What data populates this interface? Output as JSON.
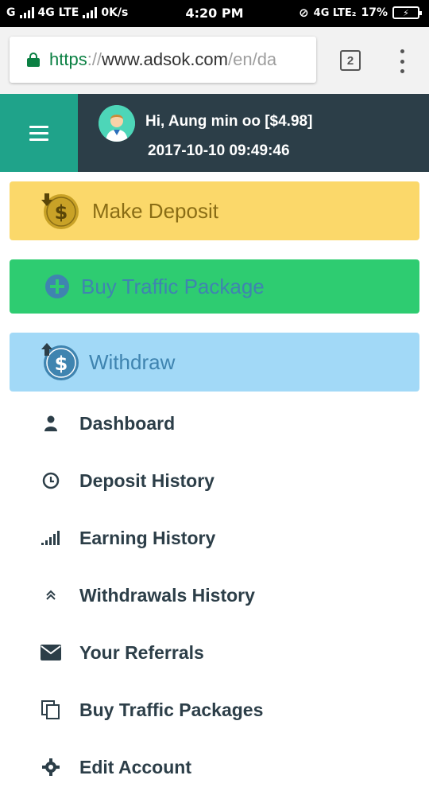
{
  "status_bar": {
    "carrier_left": "G",
    "network": "4G LTE",
    "speed": "0K/s",
    "time": "4:20 PM",
    "network_right": "4G LTE₂",
    "battery": "17%"
  },
  "browser": {
    "url_scheme": "https",
    "url_separator": "://",
    "url_host": "www.adsok.com",
    "url_path": "/en/da",
    "tab_count": "2"
  },
  "header": {
    "greeting": "Hi, Aung min oo [$4.98]",
    "datetime": "2017-10-10 09:49:46"
  },
  "actions": {
    "deposit_label": "Make Deposit",
    "traffic_label": "Buy Traffic Package",
    "withdraw_label": "Withdraw"
  },
  "menu": [
    {
      "label": "Dashboard",
      "icon": "user-icon"
    },
    {
      "label": "Deposit History",
      "icon": "clock-icon"
    },
    {
      "label": "Earning History",
      "icon": "signal-bars-icon"
    },
    {
      "label": "Withdrawals History",
      "icon": "double-chevron-up-icon"
    },
    {
      "label": "Your Referrals",
      "icon": "envelope-icon"
    },
    {
      "label": "Buy Traffic Packages",
      "icon": "copy-icon"
    },
    {
      "label": "Edit Account",
      "icon": "gear-icon"
    }
  ],
  "colors": {
    "header_bg": "#2c3e48",
    "hamburger_bg": "#1fa38a",
    "deposit_bg": "#fbd86a",
    "traffic_bg": "#2ecc71",
    "withdraw_bg": "#a2d9f7"
  }
}
